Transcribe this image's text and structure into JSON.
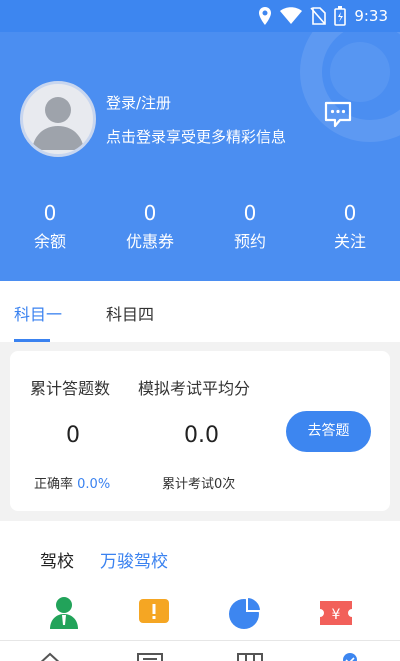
{
  "status_bar": {
    "time": "9:33"
  },
  "header": {
    "login_title": "登录/注册",
    "login_subtitle": "点击登录享受更多精彩信息"
  },
  "stats": [
    {
      "value": "0",
      "label": "余额"
    },
    {
      "value": "0",
      "label": "优惠券"
    },
    {
      "value": "0",
      "label": "预约"
    },
    {
      "value": "0",
      "label": "关注"
    }
  ],
  "tabs": [
    {
      "label": "科目一",
      "active": true
    },
    {
      "label": "科目四",
      "active": false
    }
  ],
  "quiz_card": {
    "total_answers_label": "累计答题数",
    "mock_avg_label": "模拟考试平均分",
    "total_answers_value": "0",
    "mock_avg_value": "0.0",
    "accuracy_label": "正确率",
    "accuracy_value": "0.0%",
    "exam_count_prefix": "累计考试",
    "exam_count_value": "0",
    "exam_count_suffix": "次",
    "answer_button": "去答题"
  },
  "school": {
    "label": "驾校",
    "value": "万骏驾校"
  },
  "colors": {
    "primary": "#3d86f0",
    "header_bg": "#4b8ef1",
    "accent_text": "#3a82f0"
  },
  "icons": {
    "row": [
      "coach-icon",
      "notice-icon",
      "pie-chart-icon",
      "ticket-icon"
    ],
    "bottom_nav": [
      "home-icon",
      "document-icon",
      "grid-icon",
      "profile-icon"
    ]
  }
}
